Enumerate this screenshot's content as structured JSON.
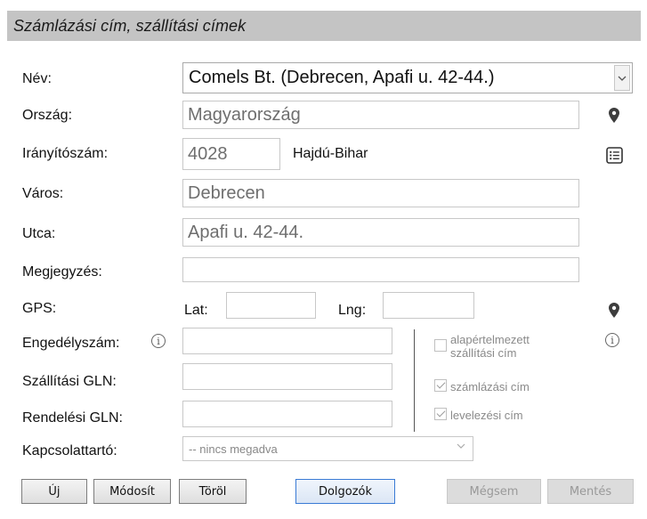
{
  "title": "Számlázási cím, szállítási címek",
  "labels": {
    "name": "Név:",
    "country": "Ország:",
    "zip": "Irányítószám:",
    "city": "Város:",
    "street": "Utca:",
    "note": "Megjegyzés:",
    "gps": "GPS:",
    "license": "Engedélyszám:",
    "shipping_gln": "Szállítási GLN:",
    "order_gln": "Rendelési GLN:",
    "contact": "Kapcsolattartó:"
  },
  "fields": {
    "name_selected": "Comels Bt. (Debrecen, Apafi u. 42-44.)",
    "country": "Magyarország",
    "zip": "4028",
    "county": "Hajdú-Bihar",
    "city": "Debrecen",
    "street": "Apafi u. 42-44.",
    "note": "",
    "lat_label": "Lat:",
    "lat": "",
    "lng_label": "Lng:",
    "lng": "",
    "license": "",
    "shipping_gln": "",
    "order_gln": "",
    "contact_selected": "-- nincs megadva"
  },
  "checkboxes": [
    {
      "label_line1": "alapértelmezett",
      "label_line2": "szállítási cím",
      "checked": false
    },
    {
      "label_line1": "számlázási cím",
      "label_line2": "",
      "checked": true
    },
    {
      "label_line1": "levelezési cím",
      "label_line2": "",
      "checked": true
    }
  ],
  "buttons": {
    "new": "Új",
    "modify": "Módosít",
    "delete": "Töröl",
    "employees": "Dolgozók",
    "cancel": "Mégsem",
    "save": "Mentés"
  },
  "icons": {
    "country_pin": "map-pin-icon",
    "zip_list": "list-icon",
    "gps_pin": "map-pin-icon",
    "license_info": "info-icon",
    "checkbox_info": "info-icon"
  },
  "info_glyph": "i"
}
